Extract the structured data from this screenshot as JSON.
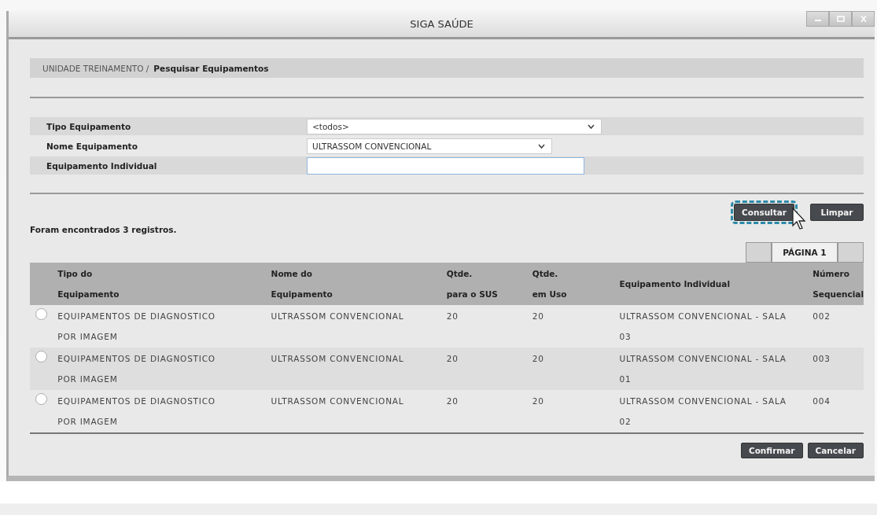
{
  "window": {
    "title": "SIGA SAÚDE"
  },
  "breadcrumb": {
    "parent": "UNIDADE TREINAMENTO /",
    "current": "Pesquisar Equipamentos"
  },
  "form": [
    {
      "label": "Tipo Equipamento",
      "kind": "select",
      "value": "<todos>"
    },
    {
      "label": "Nome Equipamento",
      "kind": "select",
      "value": "ULTRASSOM CONVENCIONAL"
    },
    {
      "label": "Equipamento Individual",
      "kind": "input"
    }
  ],
  "actions": [
    {
      "label": "Consultar",
      "focused": true
    },
    {
      "label": "Limpar",
      "focused": false
    }
  ],
  "result_count": "Foram encontrados 3 registros.",
  "pagination": {
    "label": "PÁGINA 1"
  },
  "table": {
    "columns": [
      "Tipo do\nEquipamento",
      "Nome do\nEquipamento",
      "Qtde.\npara o SUS",
      "Qtde.\nem Uso",
      "Equipamento Individual",
      "Número\nSequencial"
    ],
    "rows": [
      {
        "selected": false,
        "cells": [
          "EQUIPAMENTOS DE DIAGNOSTICO POR IMAGEM",
          "ULTRASSOM CONVENCIONAL",
          "20",
          "20",
          "ULTRASSOM CONVENCIONAL - SALA 03",
          "002"
        ]
      },
      {
        "selected": false,
        "cells": [
          "EQUIPAMENTOS DE DIAGNOSTICO POR IMAGEM",
          "ULTRASSOM CONVENCIONAL",
          "20",
          "20",
          "ULTRASSOM CONVENCIONAL - SALA 01",
          "003"
        ]
      },
      {
        "selected": false,
        "cells": [
          "EQUIPAMENTOS DE DIAGNOSTICO POR IMAGEM",
          "ULTRASSOM CONVENCIONAL",
          "20",
          "20",
          "ULTRASSOM CONVENCIONAL - SALA 02",
          "004"
        ]
      }
    ]
  },
  "footer_buttons": [
    "Confirmar",
    "Cancelar"
  ]
}
